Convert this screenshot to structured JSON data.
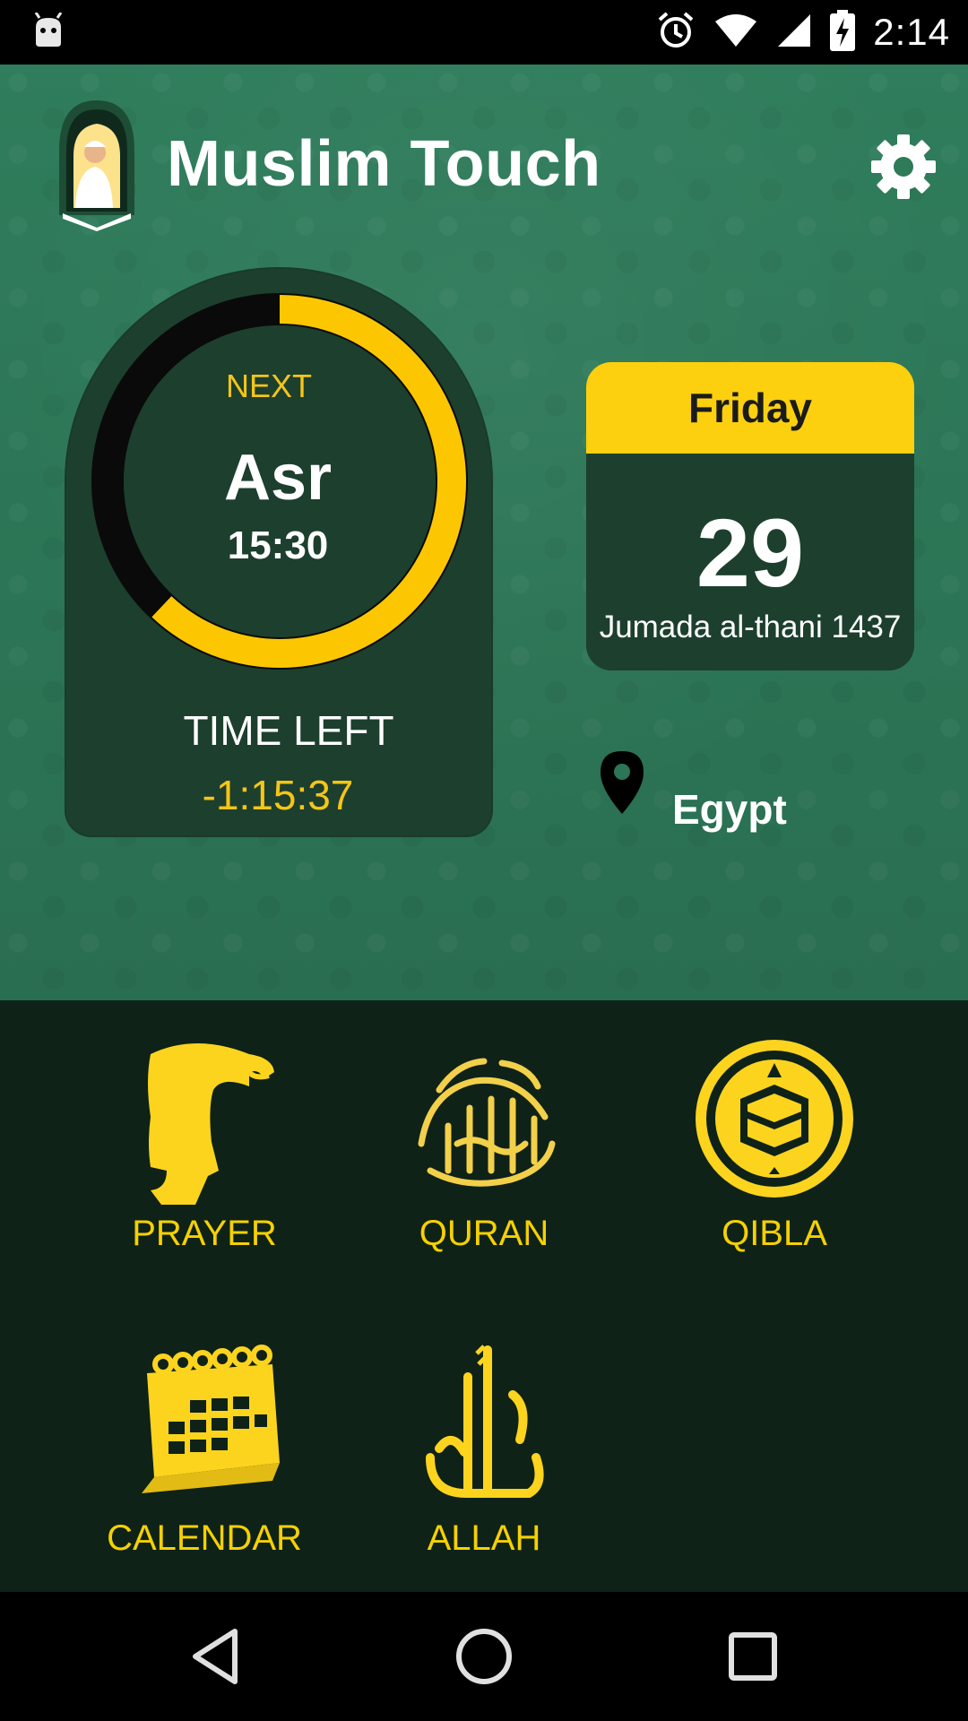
{
  "status_bar": {
    "time": "2:14",
    "icons": [
      "android-icon",
      "alarm-icon",
      "wifi-icon",
      "signal-icon",
      "battery-charging-icon"
    ]
  },
  "header": {
    "title": "Muslim Touch",
    "settings_icon": "gear-icon"
  },
  "next_prayer": {
    "label": "NEXT",
    "name": "Asr",
    "time": "15:30",
    "time_left_label": "TIME LEFT",
    "time_left_value": "-1:15:37",
    "progress": 0.62
  },
  "date": {
    "weekday": "Friday",
    "day": "29",
    "month_year": "Jumada al-thani 1437"
  },
  "location": {
    "name": "Egypt",
    "icon": "location-pin-icon"
  },
  "menu": [
    {
      "label": "PRAYER",
      "icon": "prayer-icon"
    },
    {
      "label": "QURAN",
      "icon": "quran-icon"
    },
    {
      "label": "QIBLA",
      "icon": "qibla-icon"
    },
    {
      "label": "CALENDAR",
      "icon": "calendar-icon"
    },
    {
      "label": "ALLAH",
      "icon": "allah-icon"
    }
  ],
  "nav": [
    "back-icon",
    "home-icon",
    "recents-icon"
  ],
  "colors": {
    "accent": "#fcd00e",
    "background": "#2c7556",
    "card": "#1d3f2e",
    "menu_bg": "#0f2218"
  }
}
